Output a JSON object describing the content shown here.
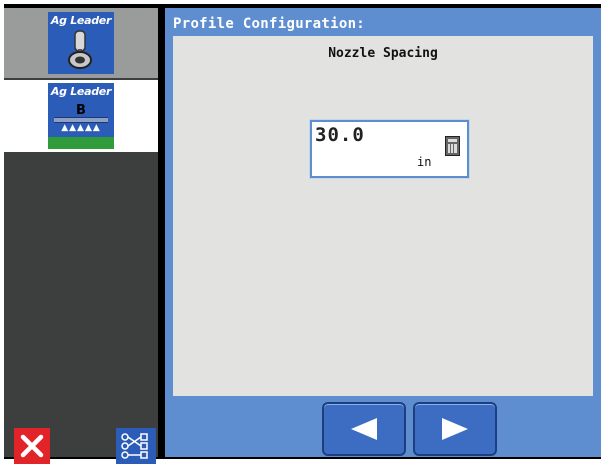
{
  "sidebar": {
    "tiles": [
      {
        "logo_text": "Ag Leader",
        "icon": "toggle-switch-icon"
      },
      {
        "logo_text": "Ag Leader",
        "letter": "B",
        "icon": "boom-sprayer-icon"
      }
    ],
    "cancel_icon": "close-icon",
    "diagnostics_icon": "network-diagram-icon"
  },
  "header": {
    "title": "Profile Configuration:"
  },
  "main": {
    "section_title": "Nozzle Spacing",
    "nozzle_spacing": {
      "value": "30.0",
      "unit": "in",
      "icon": "calculator-icon"
    }
  },
  "navigation": {
    "prev_icon": "arrow-left-icon",
    "next_icon": "arrow-right-icon"
  },
  "colors": {
    "panel_blue": "#5e8ecf",
    "sidebar_dark": "#3d3f3f",
    "button_blue": "#3d6dc3",
    "cancel_red": "#e0242a",
    "content_gray": "#e2e2e0"
  }
}
